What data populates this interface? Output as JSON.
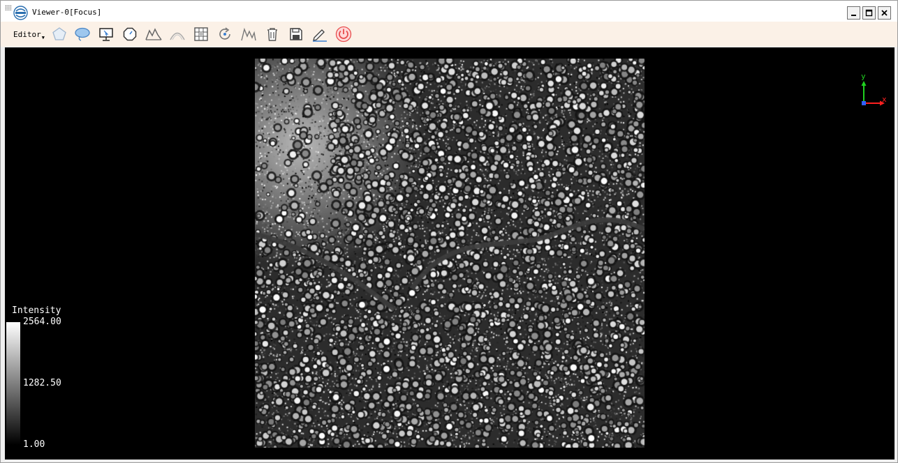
{
  "window": {
    "title": "Viewer-0[Focus]",
    "logo_icon": "lidar360-logo-icon",
    "controls": [
      "minimize-icon",
      "maximize-icon",
      "close-icon"
    ]
  },
  "toolbar": {
    "editor_label": "Editor",
    "tools": [
      {
        "name": "polygon-select-tool",
        "icon": "pentagon-icon"
      },
      {
        "name": "lasso-select-tool",
        "icon": "cloud-lasso-icon"
      },
      {
        "name": "screen-select-tool",
        "icon": "monitor-cursor-icon"
      },
      {
        "name": "circle-select-tool",
        "icon": "octagon-icon"
      },
      {
        "name": "profile-tool",
        "icon": "mountain-icon"
      },
      {
        "name": "curve-tool",
        "icon": "arc-icon"
      },
      {
        "name": "grid-tool",
        "icon": "grid-icon"
      },
      {
        "name": "rotate-tool",
        "icon": "rotate-icon"
      },
      {
        "name": "terrain-tool",
        "icon": "peaks-icon"
      },
      {
        "name": "delete-tool",
        "icon": "trash-icon"
      },
      {
        "name": "save-tool",
        "icon": "save-icon"
      },
      {
        "name": "edit-tool",
        "icon": "pen-edit-icon"
      },
      {
        "name": "exit-tool",
        "icon": "power-icon"
      }
    ]
  },
  "viewport": {
    "axes": {
      "x": "x",
      "y": "y"
    },
    "legend": {
      "title": "Intensity",
      "max": "2564.00",
      "mid": "1282.50",
      "min": "1.00"
    },
    "colors": {
      "background": "#000000",
      "x_axis": "#ff2020",
      "y_axis": "#20d020",
      "z_axis": "#3060ff",
      "power": "#e84c4c"
    }
  }
}
